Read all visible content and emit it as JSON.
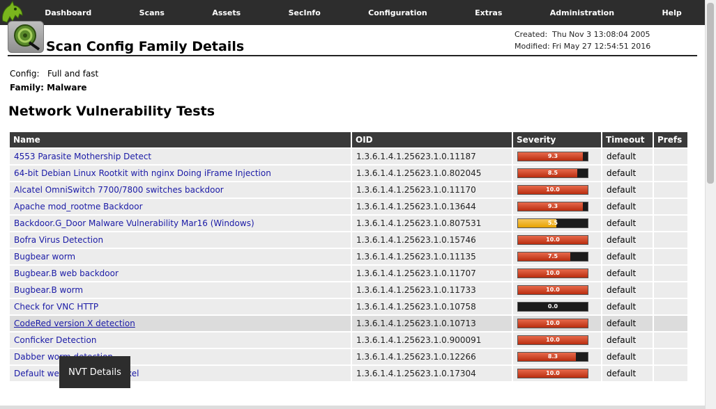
{
  "nav": {
    "items": [
      "Dashboard",
      "Scans",
      "Assets",
      "SecInfo",
      "Configuration",
      "Extras",
      "Administration",
      "Help"
    ]
  },
  "header": {
    "title": "Scan Config Family Details",
    "created_label": "Created:",
    "created_value": "Thu Nov 3 13:08:04 2005",
    "modified_label": "Modified:",
    "modified_value": "Fri May 27 12:54:51 2016"
  },
  "config": {
    "config_label": "Config:",
    "config_value": "Full and fast",
    "family_text": "Family: Malware"
  },
  "section_title": "Network Vulnerability Tests",
  "table": {
    "columns": [
      "Name",
      "OID",
      "Severity",
      "Timeout",
      "Prefs"
    ],
    "rows": [
      {
        "name": "4553 Parasite Mothership Detect",
        "oid": "1.3.6.1.4.1.25623.1.0.11187",
        "severity": "9.3",
        "severity_value": 9.3,
        "level": "high",
        "timeout": "default"
      },
      {
        "name": "64-bit Debian Linux Rootkit with nginx Doing iFrame Injection",
        "oid": "1.3.6.1.4.1.25623.1.0.802045",
        "severity": "8.5",
        "severity_value": 8.5,
        "level": "high",
        "timeout": "default"
      },
      {
        "name": "Alcatel OmniSwitch 7700/7800 switches backdoor",
        "oid": "1.3.6.1.4.1.25623.1.0.11170",
        "severity": "10.0",
        "severity_value": 10.0,
        "level": "high",
        "timeout": "default"
      },
      {
        "name": "Apache mod_rootme Backdoor",
        "oid": "1.3.6.1.4.1.25623.1.0.13644",
        "severity": "9.3",
        "severity_value": 9.3,
        "level": "high",
        "timeout": "default"
      },
      {
        "name": "Backdoor.G_Door Malware Vulnerability Mar16 (Windows)",
        "oid": "1.3.6.1.4.1.25623.1.0.807531",
        "severity": "5.5",
        "severity_value": 5.5,
        "level": "med",
        "timeout": "default"
      },
      {
        "name": "Bofra Virus Detection",
        "oid": "1.3.6.1.4.1.25623.1.0.15746",
        "severity": "10.0",
        "severity_value": 10.0,
        "level": "high",
        "timeout": "default"
      },
      {
        "name": "Bugbear worm",
        "oid": "1.3.6.1.4.1.25623.1.0.11135",
        "severity": "7.5",
        "severity_value": 7.5,
        "level": "high",
        "timeout": "default"
      },
      {
        "name": "Bugbear.B web backdoor",
        "oid": "1.3.6.1.4.1.25623.1.0.11707",
        "severity": "10.0",
        "severity_value": 10.0,
        "level": "high",
        "timeout": "default"
      },
      {
        "name": "Bugbear.B worm",
        "oid": "1.3.6.1.4.1.25623.1.0.11733",
        "severity": "10.0",
        "severity_value": 10.0,
        "level": "high",
        "timeout": "default"
      },
      {
        "name": "Check for VNC HTTP",
        "oid": "1.3.6.1.4.1.25623.1.0.10758",
        "severity": "0.0",
        "severity_value": 0.0,
        "level": "none",
        "timeout": "default"
      },
      {
        "name": "CodeRed version X detection",
        "oid": "1.3.6.1.4.1.25623.1.0.10713",
        "severity": "10.0",
        "severity_value": 10.0,
        "level": "high",
        "timeout": "default",
        "highlight": true
      },
      {
        "name": "Conficker Detection",
        "oid": "1.3.6.1.4.1.25623.1.0.900091",
        "severity": "10.0",
        "severity_value": 10.0,
        "level": "high",
        "timeout": "default"
      },
      {
        "name": "Dabber worm detection",
        "oid": "1.3.6.1.4.1.25623.1.0.12266",
        "severity": "8.3",
        "severity_value": 8.3,
        "level": "high",
        "timeout": "default"
      },
      {
        "name": "Default web account on Zyxel",
        "oid": "1.3.6.1.4.1.25623.1.0.17304",
        "severity": "10.0",
        "severity_value": 10.0,
        "level": "high",
        "timeout": "default"
      }
    ]
  },
  "tooltip": "NVT Details",
  "colors": {
    "nav_bg": "#2d2d2d",
    "link": "#1a1aa6",
    "severity_high": "#c8391b",
    "severity_medium": "#f0b400"
  }
}
